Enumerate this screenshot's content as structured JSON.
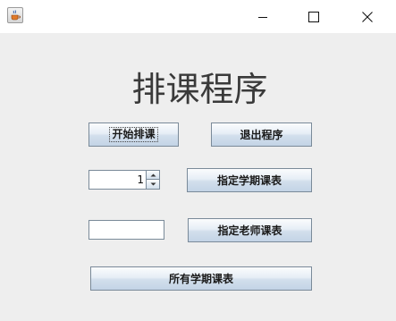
{
  "window": {
    "title": "",
    "icon": "java-cup-icon",
    "controls": [
      "minimize-icon",
      "maximize-icon",
      "close-icon"
    ]
  },
  "main": {
    "title": "排课程序",
    "buttons": {
      "start": "开始排课",
      "exit": "退出程序",
      "term_schedule": "指定学期课表",
      "teacher_schedule": "指定老师课表",
      "all_schedules": "所有学期课表"
    },
    "term_spinner": {
      "value": "1"
    },
    "teacher_input": {
      "value": ""
    }
  },
  "colors": {
    "background": "#eeeeee",
    "titlebar": "#ffffff",
    "button_border": "#7a8a99",
    "button_gradient_top": "#fbfcfd",
    "button_gradient_bottom": "#c3d4e6",
    "title_text": "#3a3a3a"
  }
}
